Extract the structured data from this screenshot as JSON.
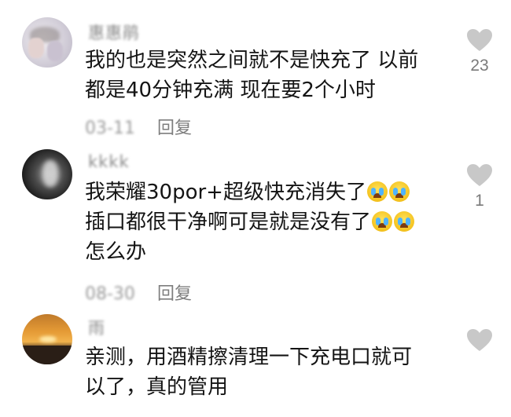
{
  "comments": [
    {
      "username": "惠惠鹃",
      "text_lines": [
        "我的也是突然之间就不是快充了 以前",
        "都是40分钟充满 现在要2个小时"
      ],
      "date": "03-11",
      "reply_label": "回复",
      "like_count": "23"
    },
    {
      "username": "kkkk",
      "text_lines": [
        "我荣耀30por+超级快充消失了",
        "插口都很干净啊可是就是没有了",
        "怎么办"
      ],
      "date": "08-30",
      "reply_label": "回复",
      "like_count": "1"
    },
    {
      "username": "雨",
      "text_lines": [
        "亲测，用酒精擦清理一下充电口就可",
        "以了，真的管用"
      ],
      "date": "",
      "reply_label": "",
      "like_count": ""
    }
  ],
  "icons": {
    "like": "heart-icon",
    "crying": "loudly-crying-face-emoji"
  },
  "colors": {
    "heart": "#c8c8c8",
    "meta_text": "#9a9a9a"
  }
}
